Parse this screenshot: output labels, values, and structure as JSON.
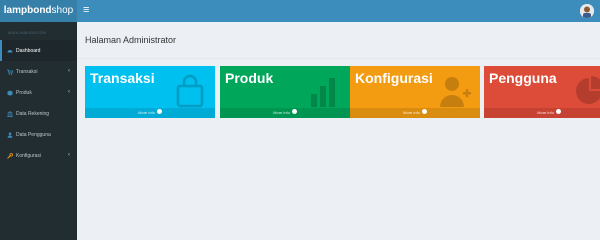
{
  "header": {
    "logo_bold": "lampbond",
    "logo_light": "shop",
    "toggle": "≡"
  },
  "sidebar": {
    "section_header": "MAIN NAVIGATION",
    "items": [
      {
        "label": "Dashboard",
        "icon": "dashboard-icon",
        "active": true
      },
      {
        "label": "Transaksi",
        "icon": "cart-icon",
        "caret": "‹"
      },
      {
        "label": "Produk",
        "icon": "cube-icon",
        "caret": "‹"
      },
      {
        "label": "Data Rekening",
        "icon": "bank-icon"
      },
      {
        "label": "Data Pengguna",
        "icon": "users-icon"
      },
      {
        "label": "Konfigurasi",
        "icon": "wrench-icon",
        "caret": "‹"
      }
    ]
  },
  "main": {
    "page_title": "Halaman Administrator",
    "boxes": [
      {
        "title": "Transaksi",
        "more": "More info",
        "color": "#00c0ef",
        "icon": "shopping-bag-icon"
      },
      {
        "title": "Produk",
        "more": "More info",
        "color": "#00a65a",
        "icon": "bar-chart-icon"
      },
      {
        "title": "Konfigurasi",
        "more": "More info",
        "color": "#f39c12",
        "icon": "user-plus-icon"
      },
      {
        "title": "Pengguna",
        "more": "More info",
        "color": "#dd4b39",
        "icon": "pie-chart-icon"
      }
    ]
  },
  "colors": {
    "topbar": "#3c8dbc",
    "logo_bg": "#367fa9",
    "sidebar": "#222d32",
    "content_bg": "#ecf0f5"
  }
}
